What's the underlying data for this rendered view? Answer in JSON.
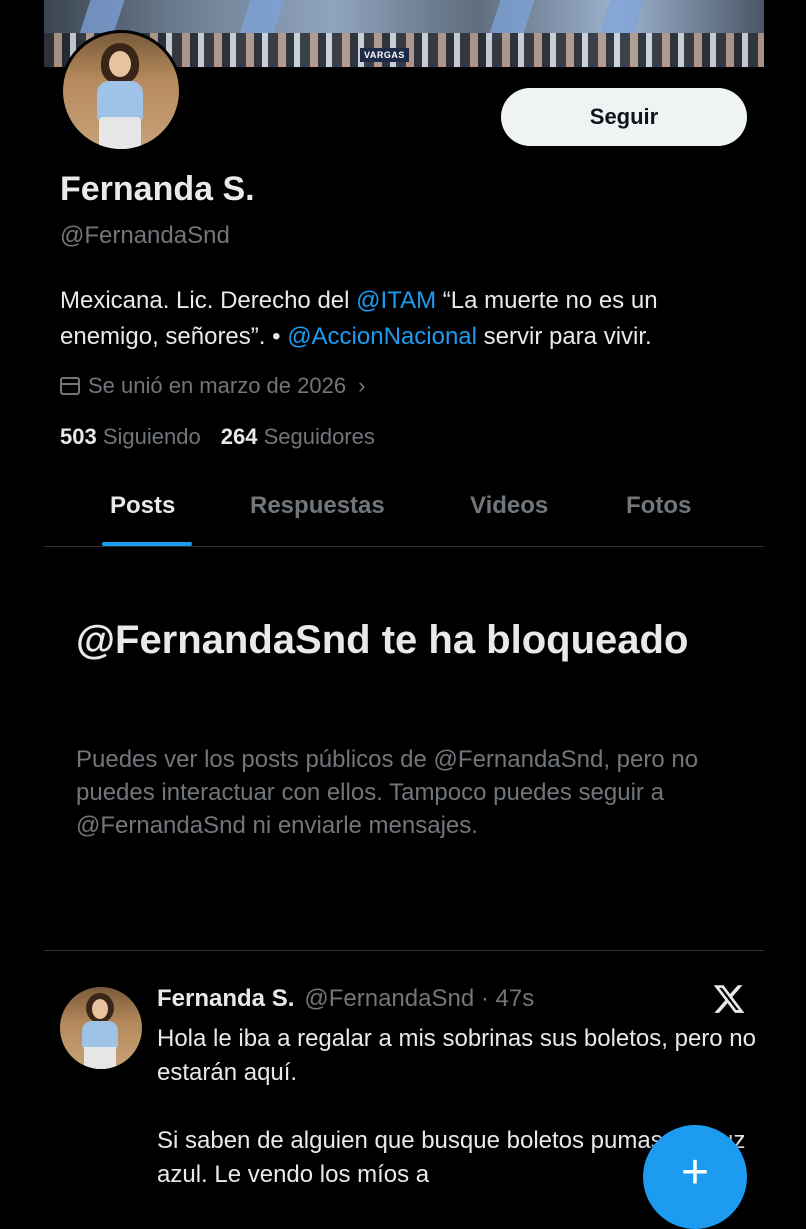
{
  "banner": {
    "sign_text": "VARGAS"
  },
  "profile": {
    "follow_label": "Seguir",
    "name": "Fernanda S.",
    "handle": "@FernandaSnd",
    "bio": {
      "part1": "Mexicana. Lic. Derecho del ",
      "mention1": "@ITAM",
      "part2": " “La muerte no es un enemigo, señores”. • ",
      "mention2": "@AccionNacional",
      "part3": " servir para vivir."
    },
    "joined": "Se unió en marzo de 2026",
    "following_count": "503",
    "following_label": "Siguiendo",
    "followers_count": "264",
    "followers_label": "Seguidores"
  },
  "tabs": [
    {
      "label": "Posts",
      "active": true
    },
    {
      "label": "Respuestas"
    },
    {
      "label": "Videos"
    },
    {
      "label": "Fotos"
    }
  ],
  "blocked": {
    "title": "@FernandaSnd te ha bloqueado",
    "description": "Puedes ver los posts públicos de @FernandaSnd, pero no puedes interactuar con ellos. Tampoco puedes seguir a @FernandaSnd ni enviarle mensajes."
  },
  "post": {
    "name": "Fernanda S.",
    "meta": "@FernandaSnd · 47s",
    "text": "Hola le iba a regalar a mis sobrinas sus boletos, pero no estarán aquí.\n\nSi saben de alguien que busque boletos pumas vs cruz azul. Le vendo los míos a"
  },
  "icons": {
    "calendar": "calendar-icon",
    "chevron": "chevron-right-icon",
    "x_logo": "x-logo-icon",
    "compose": "plus-icon"
  },
  "colors": {
    "accent": "#1d9bf0",
    "background": "#000000",
    "muted": "#71767b",
    "text": "#e7e9ea"
  }
}
